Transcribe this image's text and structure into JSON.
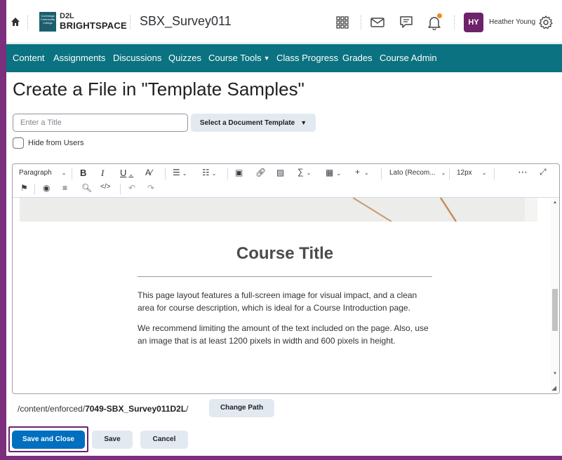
{
  "header": {
    "logo_school": "Conestoga Community College",
    "logo_d2l": "D2L",
    "logo_brightspace": "BRIGHTSPACE",
    "course_name": "SBX_Survey011",
    "avatar_initials": "HY",
    "user_name": "Heather Young"
  },
  "nav": {
    "items": [
      "Content",
      "Assignments",
      "Discussions",
      "Quizzes",
      "Course Tools",
      "Class Progress",
      "Grades",
      "Course Admin"
    ]
  },
  "page": {
    "title": "Create a File in \"Template Samples\""
  },
  "form": {
    "title_placeholder": "Enter a Title",
    "title_value": "",
    "template_button": "Select a Document Template",
    "hide_label": "Hide from Users",
    "hide_checked": false
  },
  "toolbar": {
    "paragraph": "Paragraph",
    "font": "Lato (Recom...",
    "size": "12px"
  },
  "document": {
    "course_title": "Course Title",
    "para1": "This page layout features a full-screen image for visual impact, and a clean area for course description, which is ideal for a Course Introduction page.",
    "para2": "We recommend limiting the amount of the text included on the page. Also, use an image that is at least 1200 pixels in width and 600 pixels in height."
  },
  "path": {
    "prefix": "/content/enforced/",
    "folder": "7049-SBX_Survey011D2L",
    "suffix": "/",
    "change_label": "Change Path"
  },
  "actions": {
    "save_close": "Save and Close",
    "save": "Save",
    "cancel": "Cancel"
  },
  "colors": {
    "nav_bg": "#0a7280",
    "primary": "#006fbf",
    "accent": "#6d2269",
    "notification": "#f08b1d"
  }
}
